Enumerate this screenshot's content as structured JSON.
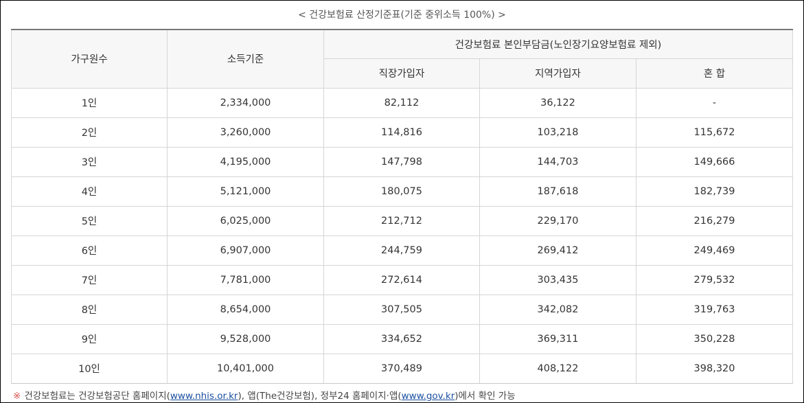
{
  "caption": "< 건강보험료 산정기준표(기준 중위소득 100%) >",
  "table": {
    "headers": {
      "household": "가구원수",
      "income": "소득기준",
      "premium_group": "건강보험료 본인부담금(노인장기요양보험료 제외)",
      "employee": "직장가입자",
      "regional": "지역가입자",
      "mixed": "혼 합"
    },
    "rows": [
      {
        "household": "1인",
        "income": "2,334,000",
        "employee": "82,112",
        "regional": "36,122",
        "mixed": "-"
      },
      {
        "household": "2인",
        "income": "3,260,000",
        "employee": "114,816",
        "regional": "103,218",
        "mixed": "115,672"
      },
      {
        "household": "3인",
        "income": "4,195,000",
        "employee": "147,798",
        "regional": "144,703",
        "mixed": "149,666"
      },
      {
        "household": "4인",
        "income": "5,121,000",
        "employee": "180,075",
        "regional": "187,618",
        "mixed": "182,739"
      },
      {
        "household": "5인",
        "income": "6,025,000",
        "employee": "212,712",
        "regional": "229,170",
        "mixed": "216,279"
      },
      {
        "household": "6인",
        "income": "6,907,000",
        "employee": "244,759",
        "regional": "269,412",
        "mixed": "249,469"
      },
      {
        "household": "7인",
        "income": "7,781,000",
        "employee": "272,614",
        "regional": "303,435",
        "mixed": "279,532"
      },
      {
        "household": "8인",
        "income": "8,654,000",
        "employee": "307,505",
        "regional": "342,082",
        "mixed": "319,763"
      },
      {
        "household": "9인",
        "income": "9,528,000",
        "employee": "334,652",
        "regional": "369,311",
        "mixed": "350,228"
      },
      {
        "household": "10인",
        "income": "10,401,000",
        "employee": "370,489",
        "regional": "408,122",
        "mixed": "398,320"
      }
    ]
  },
  "footnote": {
    "mark": "※",
    "text_1": "건강보험료는 건강보험공단 홈페이지(",
    "link_1": "www.nhis.or.kr",
    "text_2": "), 앱(The건강보험), 정부24 홈페이지·앱(",
    "link_2": "www.gov.kr",
    "text_3": ")에서 확인 가능"
  }
}
